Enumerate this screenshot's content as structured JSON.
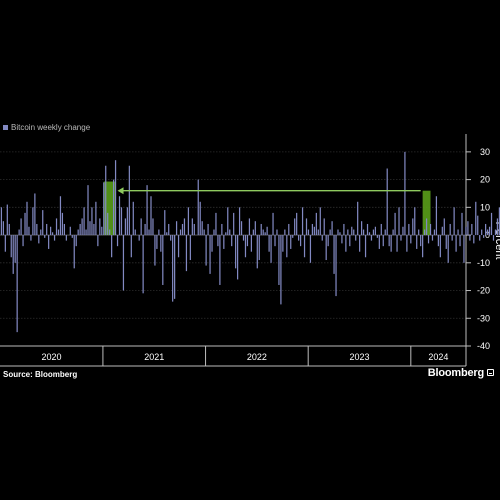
{
  "chart_data": {
    "type": "bar",
    "title": "",
    "xlabel": "",
    "ylabel": "Percent",
    "ylim": [
      -40,
      35
    ],
    "yticks": [
      30,
      20,
      10,
      0,
      -10,
      -20,
      -30,
      -40
    ],
    "yaxis_side": "right",
    "xtick_labels": [
      "2020",
      "2021",
      "2022",
      "2023",
      "2024"
    ],
    "grid": true,
    "legend_position": "top-left",
    "x_start": "2020-01-06",
    "week_step": 1,
    "series": [
      {
        "name": "Bitcoin weekly change",
        "color": "#8289c2",
        "values": [
          10,
          5,
          -6,
          11,
          4,
          -8,
          -14,
          -10,
          -35,
          2,
          6,
          -4,
          8,
          12,
          3,
          -2,
          10,
          15,
          4,
          -3,
          2,
          9,
          -1,
          4,
          -5,
          3,
          1,
          -2,
          6,
          2,
          14,
          8,
          4,
          -2,
          0,
          3,
          -1,
          -12,
          -4,
          2,
          4,
          6,
          10,
          2,
          18,
          5,
          10,
          4,
          12,
          -4,
          6,
          3,
          19,
          25,
          8,
          2,
          -8,
          20,
          27,
          -4,
          14,
          10,
          -20,
          6,
          10,
          25,
          -8,
          12,
          2,
          0,
          -2,
          6,
          -21,
          4,
          18,
          2,
          14,
          6,
          -11,
          -5,
          2,
          -6,
          -18,
          9,
          1,
          4,
          -2,
          -24,
          -23,
          5,
          -8,
          2,
          4,
          6,
          -13,
          10,
          -9,
          6,
          4,
          0,
          20,
          12,
          5,
          2,
          -11,
          4,
          -14,
          -6,
          2,
          8,
          -4,
          -18,
          4,
          -5,
          1,
          10,
          2,
          -4,
          8,
          -12,
          -16,
          10,
          5,
          -2,
          -8,
          -4,
          6,
          -6,
          2,
          5,
          -12,
          -9,
          4,
          2,
          1,
          3,
          -6,
          -10,
          8,
          -4,
          2,
          -18,
          -25,
          -6,
          2,
          -8,
          4,
          -5,
          -1,
          6,
          8,
          -2,
          -4,
          10,
          -8,
          6,
          2,
          -10,
          4,
          3,
          8,
          2,
          10,
          -2,
          6,
          -9,
          -4,
          2,
          5,
          -14,
          -22,
          2,
          1,
          -3,
          4,
          -6,
          2,
          -4,
          3,
          2,
          -2,
          12,
          -6,
          5,
          2,
          -8,
          4,
          1,
          -2,
          2,
          3,
          -1,
          -5,
          4,
          -4,
          2,
          24,
          -4,
          -6,
          2,
          8,
          -6,
          10,
          -2,
          3,
          30,
          -6,
          4,
          -3,
          6,
          10,
          -5,
          2,
          -4,
          -8,
          2,
          6,
          -3,
          4,
          -2,
          2,
          14,
          -4,
          -8,
          3,
          6,
          -5,
          -10,
          4,
          -2,
          10,
          -6,
          2,
          -4,
          8,
          -10,
          3,
          5,
          -2,
          4,
          -3,
          12,
          7,
          -2,
          2,
          -1,
          4,
          2,
          3,
          8,
          -2,
          2,
          6,
          10,
          -4,
          4,
          22,
          13,
          -8,
          6,
          4,
          -6,
          10,
          -5,
          12,
          2,
          -8,
          4,
          -3,
          6,
          2,
          -2,
          8,
          12,
          -6,
          -10,
          3,
          4,
          -12,
          6,
          -4,
          2,
          9,
          5,
          -3,
          -8,
          10,
          4,
          12,
          8,
          -6,
          3,
          6,
          2
        ]
      }
    ],
    "annotations": [
      {
        "type": "highlight",
        "date_start": "2021-01-04",
        "date_end": "2021-02-15",
        "value": 19.3,
        "color": "#5a9e1a"
      },
      {
        "type": "highlight",
        "date_start": "2024-02-12",
        "date_end": "2024-03-11",
        "value": 16.0,
        "color": "#5a9e1a"
      },
      {
        "type": "arrow",
        "from_date": "2024-02-05",
        "to_date": "2021-02-22",
        "value": 16.0,
        "color": "#8fca5f"
      }
    ]
  },
  "legend": {
    "label": "Bitcoin weekly change",
    "swatch_color": "#8289c2"
  },
  "footer": {
    "source": "Source: Bloomberg",
    "brand": "Bloomberg"
  }
}
